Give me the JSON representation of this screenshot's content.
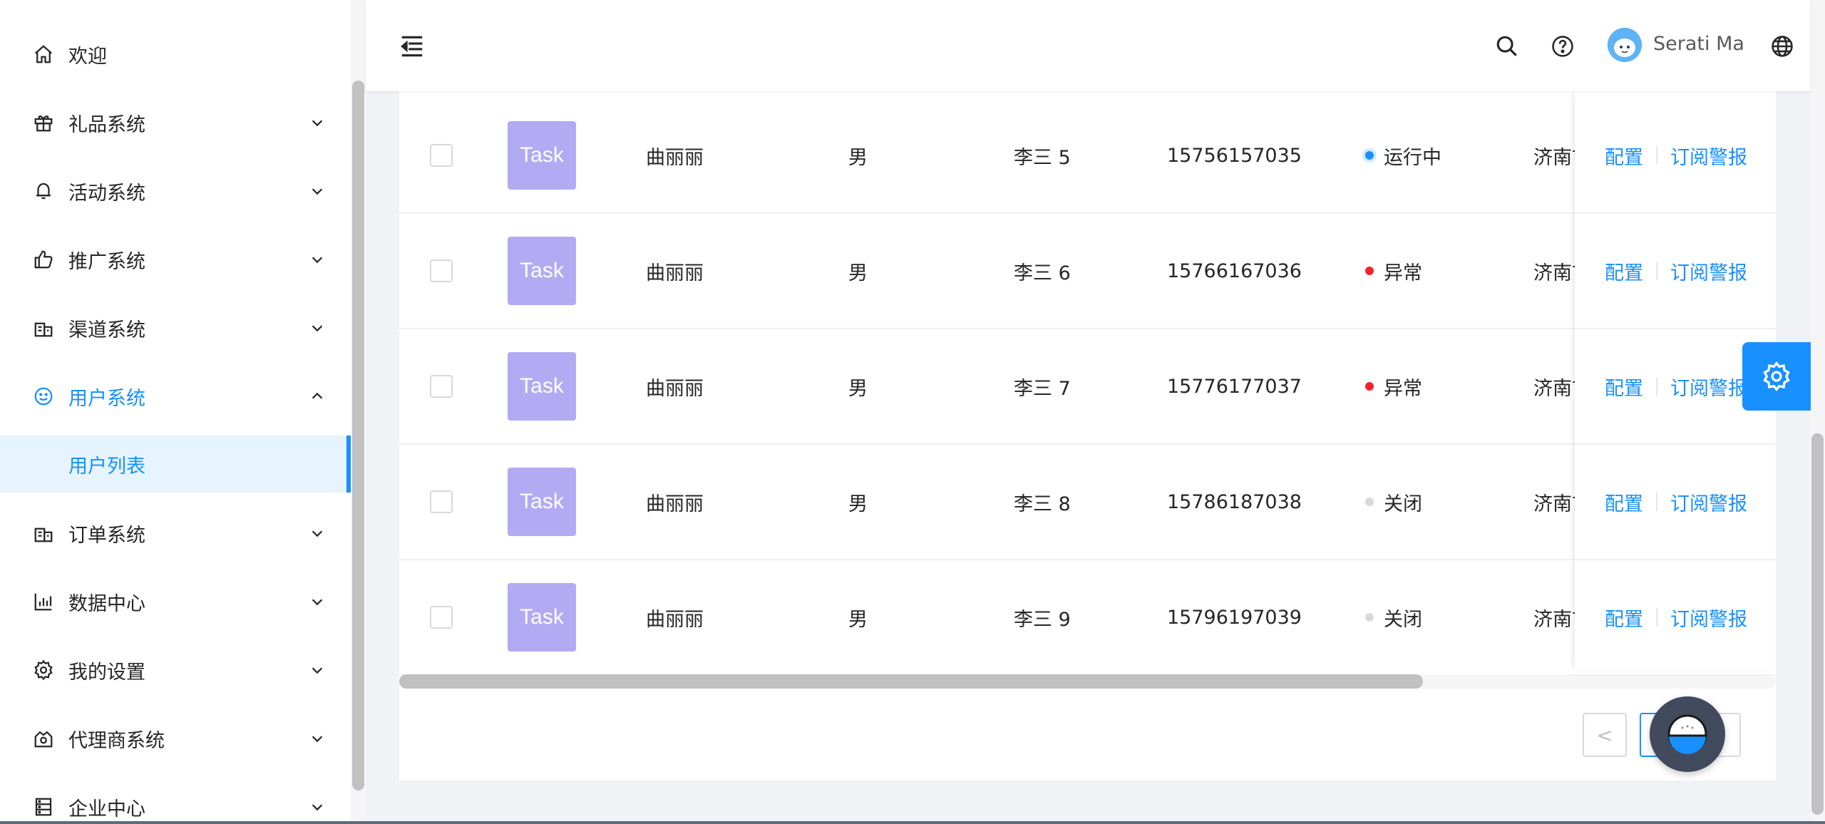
{
  "sidebar": {
    "items": [
      {
        "label": "欢迎",
        "icon": "home-icon",
        "expandable": false
      },
      {
        "label": "礼品系统",
        "icon": "gift-icon",
        "expandable": true
      },
      {
        "label": "活动系统",
        "icon": "bell-icon",
        "expandable": true
      },
      {
        "label": "推广系统",
        "icon": "thumbs-up-icon",
        "expandable": true
      },
      {
        "label": "渠道系统",
        "icon": "bank-icon",
        "expandable": true
      },
      {
        "label": "用户系统",
        "icon": "smile-icon",
        "expandable": true,
        "open": true
      },
      {
        "label": "用户列表",
        "submenu": true,
        "selected": true
      },
      {
        "label": "订单系统",
        "icon": "bank-icon",
        "expandable": true
      },
      {
        "label": "数据中心",
        "icon": "bar-chart-icon",
        "expandable": true
      },
      {
        "label": "我的设置",
        "icon": "gear-icon",
        "expandable": true
      },
      {
        "label": "代理商系统",
        "icon": "shop-icon",
        "expandable": true
      },
      {
        "label": "企业中心",
        "icon": "database-icon",
        "expandable": true
      }
    ]
  },
  "header": {
    "user_name": "Serati Ma"
  },
  "table": {
    "rows": [
      {
        "img_text": "Task",
        "name": "曲丽丽",
        "gender": "男",
        "owner": "李三 5",
        "phone": "15756157035",
        "status": "运行中",
        "status_type": "processing",
        "city": "济南市"
      },
      {
        "img_text": "Task",
        "name": "曲丽丽",
        "gender": "男",
        "owner": "李三 6",
        "phone": "15766167036",
        "status": "异常",
        "status_type": "error",
        "city": "济南市"
      },
      {
        "img_text": "Task",
        "name": "曲丽丽",
        "gender": "男",
        "owner": "李三 7",
        "phone": "15776177037",
        "status": "异常",
        "status_type": "error",
        "city": "济南市"
      },
      {
        "img_text": "Task",
        "name": "曲丽丽",
        "gender": "男",
        "owner": "李三 8",
        "phone": "15786187038",
        "status": "关闭",
        "status_type": "default",
        "city": "济南市"
      },
      {
        "img_text": "Task",
        "name": "曲丽丽",
        "gender": "男",
        "owner": "李三 9",
        "phone": "15796197039",
        "status": "关闭",
        "status_type": "default",
        "city": "济南市"
      }
    ],
    "action_config": "配置",
    "action_subscribe": "订阅警报"
  },
  "pagination": {
    "prev": "<"
  },
  "colors": {
    "primary": "#1890ff",
    "error": "#f5222d",
    "default": "#d9d9d9",
    "task_bg": "#b2aaf2"
  }
}
